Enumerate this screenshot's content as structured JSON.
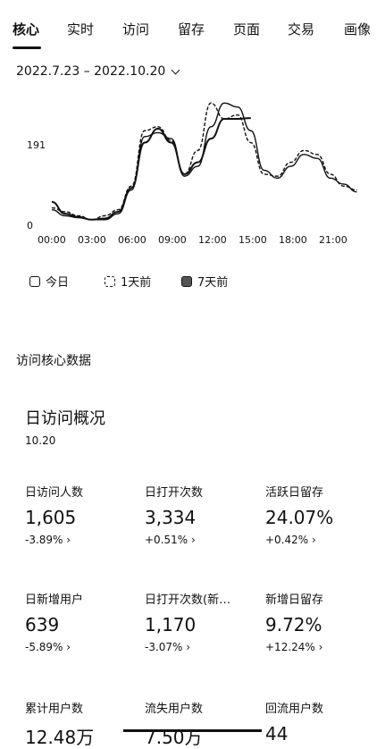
{
  "tabs": [
    "核心",
    "实时",
    "访问",
    "留存",
    "页面",
    "交易",
    "画像"
  ],
  "date_range": "2022.7.23 – 2022.10.20",
  "chart_data": {
    "type": "line",
    "x_ticks": [
      "00:00",
      "03:00",
      "06:00",
      "09:00",
      "12:00",
      "15:00",
      "18:00",
      "21:00"
    ],
    "y_ticks": [
      "191",
      "0"
    ],
    "ylim": [
      0,
      330
    ],
    "series": [
      {
        "name": "今日",
        "style": "solid",
        "x": [
          0,
          1,
          2,
          3,
          4,
          5,
          6,
          7,
          8,
          9,
          10,
          11,
          12,
          13,
          14,
          15
        ],
        "y": [
          50,
          20,
          12,
          5,
          8,
          25,
          85,
          200,
          235,
          200,
          120,
          150,
          210,
          260,
          260,
          262
        ]
      },
      {
        "name": "1天前",
        "style": "dashed",
        "x": [
          0,
          1,
          2,
          3,
          4,
          5,
          6,
          7,
          8,
          9,
          10,
          11,
          12,
          13,
          14,
          15,
          16,
          17,
          18,
          19,
          20,
          21,
          22,
          23
        ],
        "y": [
          35,
          25,
          15,
          5,
          15,
          30,
          90,
          230,
          240,
          205,
          120,
          180,
          300,
          260,
          270,
          200,
          120,
          115,
          150,
          180,
          170,
          120,
          90,
          80
        ]
      },
      {
        "name": "7天前",
        "style": "solid",
        "x": [
          0,
          1,
          2,
          3,
          4,
          5,
          6,
          7,
          8,
          9,
          10,
          11,
          12,
          13,
          14,
          15,
          16,
          17,
          18,
          19,
          20,
          21,
          22,
          23
        ],
        "y": [
          30,
          15,
          10,
          5,
          5,
          20,
          80,
          215,
          225,
          210,
          115,
          140,
          240,
          300,
          290,
          230,
          130,
          110,
          140,
          170,
          160,
          110,
          95,
          75
        ]
      }
    ],
    "legend": "bottom-left",
    "grid": false
  },
  "legend_items": [
    {
      "label": "今日",
      "style": "solid"
    },
    {
      "label": "1天前",
      "style": "dashed"
    },
    {
      "label": "7天前",
      "style": "filled"
    }
  ],
  "section_title": "访问核心数据",
  "card": {
    "title": "日访问概况",
    "date": "10.20"
  },
  "metrics": [
    {
      "label": "日访问人数",
      "value": "1,605",
      "change": "-3.89% ›"
    },
    {
      "label": "日打开次数",
      "value": "3,334",
      "change": "+0.51% ›"
    },
    {
      "label": "活跃日留存",
      "value": "24.07%",
      "change": "+0.42% ›"
    },
    {
      "label": "日新增用户",
      "value": "639",
      "change": "-5.89% ›"
    },
    {
      "label": "日打开次数(新…",
      "value": "1,170",
      "change": "-3.07% ›"
    },
    {
      "label": "新增日留存",
      "value": "9.72%",
      "change": "+12.24% ›"
    },
    {
      "label": "累计用户数",
      "value": "12.48万",
      "change": ""
    },
    {
      "label": "流失用户数",
      "value": "7.50万",
      "change": ""
    },
    {
      "label": "回流用户数",
      "value": "44",
      "change": ""
    }
  ]
}
